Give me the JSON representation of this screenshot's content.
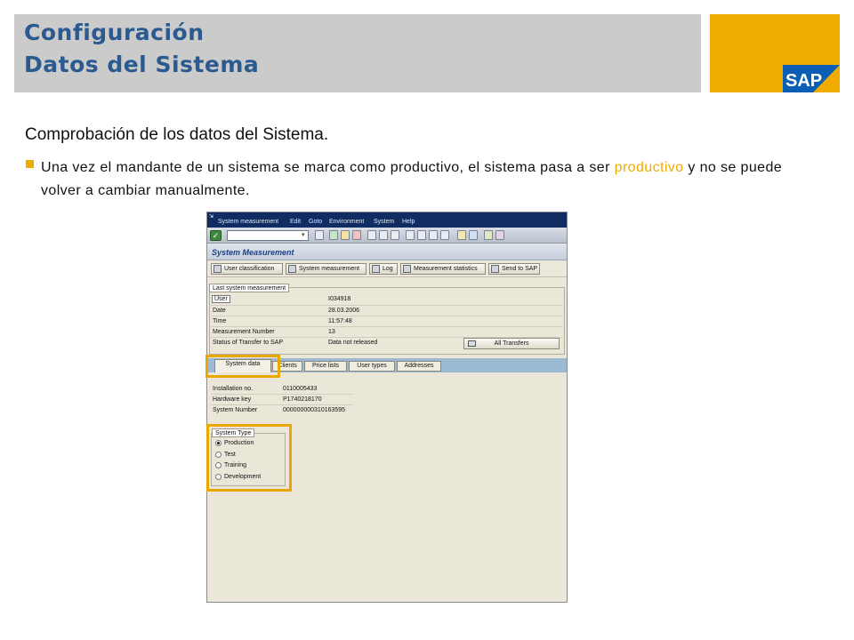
{
  "slide": {
    "title_line1": "Configuración",
    "title_line2": "Datos del Sistema",
    "logo_text": "SAP",
    "subtitle": "Comprobación de los datos del Sistema.",
    "bullet_before": "Una vez el mandante de un sistema se marca como productivo, el sistema pasa a ser ",
    "bullet_highlight": "productivo",
    "bullet_after": " y no se puede volver a cambiar manualmente.",
    "colors": {
      "accent": "#f0ab00",
      "title": "#2a5a8f",
      "band": "#cbcbcb"
    }
  },
  "sap": {
    "menu": [
      "System measurement",
      "Edit",
      "Goto",
      "Environment",
      "System",
      "Help"
    ],
    "window_title": "System Measurement",
    "app_toolbar": [
      "User classification",
      "System measurement",
      "Log",
      "Measurement statistics",
      "Send to SAP"
    ],
    "last_measurement": {
      "group_label": "Last system measurement",
      "fields": [
        {
          "label": "User",
          "value": "I034918"
        },
        {
          "label": "Date",
          "value": "28.03.2006"
        },
        {
          "label": "Time",
          "value": "11:57:48"
        },
        {
          "label": "Measurement Number",
          "value": "13"
        },
        {
          "label": "Status of Transfer to SAP",
          "value": "Data not released"
        }
      ],
      "all_transfers_button": "All Transfers"
    },
    "tabs": [
      "System data",
      "Clients",
      "Price lists",
      "User types",
      "Addresses"
    ],
    "system_data": {
      "fields": [
        {
          "label": "Installation no.",
          "value": "0110005433"
        },
        {
          "label": "Hardware key",
          "value": "P1740218170"
        },
        {
          "label": "System Number",
          "value": "000000000310163595"
        }
      ],
      "system_type": {
        "group_label": "System Type",
        "options": [
          "Production",
          "Test",
          "Training",
          "Development"
        ],
        "selected": "Production"
      }
    }
  }
}
